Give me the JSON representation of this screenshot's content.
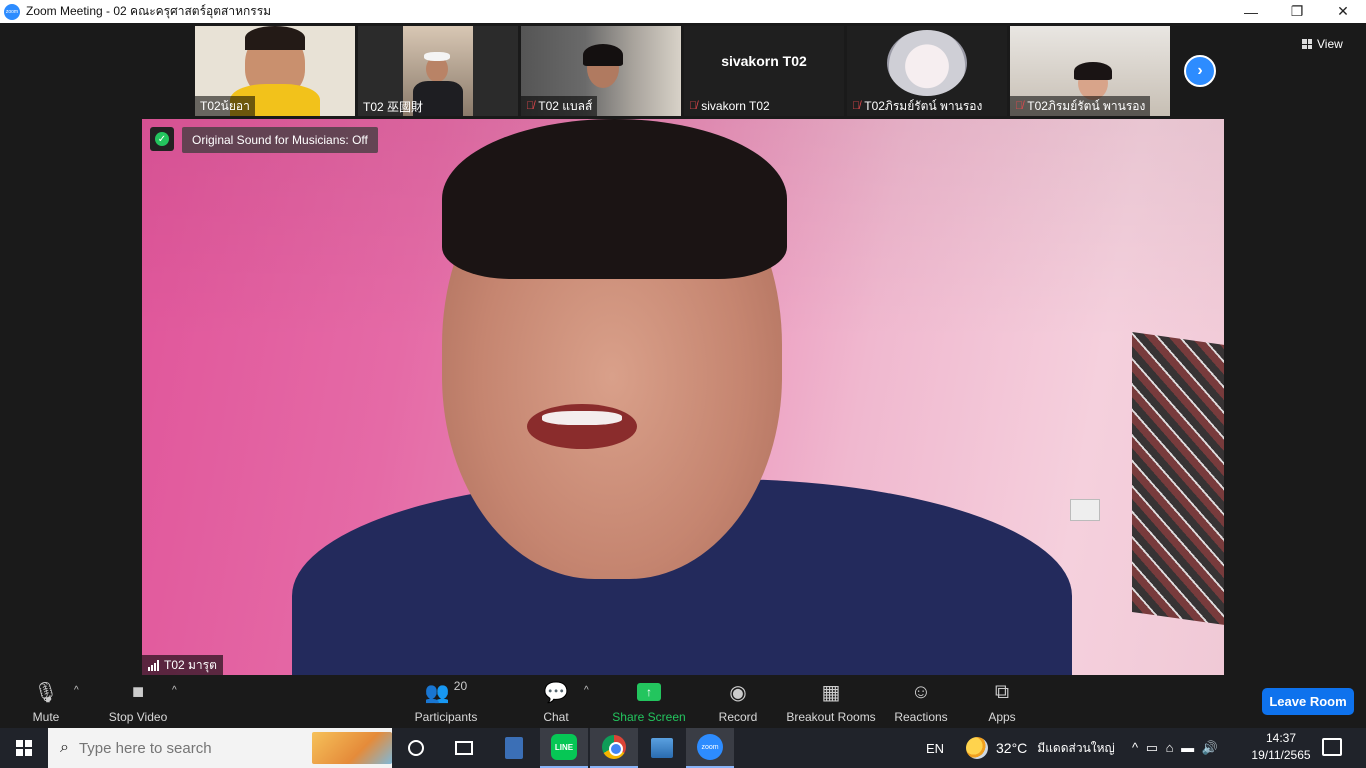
{
  "window": {
    "title": "Zoom Meeting - 02 คณะครุศาสตร์อุตสาหกรรม",
    "logo_text": "zoom",
    "controls": [
      "—",
      "❐",
      "✕"
    ]
  },
  "strip": {
    "thumbnails": [
      {
        "name": "T02น้ยอา",
        "muted": false,
        "has_video": true,
        "bg": "#d9d0c4"
      },
      {
        "name": "T02 巫國財",
        "muted": false,
        "has_video": true,
        "bg": "#3a3a3a"
      },
      {
        "name": "T02 แบลส์",
        "muted": true,
        "has_video": true,
        "bg": "#4a4a4a"
      },
      {
        "name": "sivakorn T02",
        "muted": true,
        "has_video": false,
        "display_title": "sivakorn T02",
        "bg": "#1f1f1f"
      },
      {
        "name": "T02ภิรมย์รัตน์ พานรอง",
        "muted": true,
        "has_video": true,
        "bg": "#1f1f1f"
      },
      {
        "name": "T02ภิรมย์รัตน์ พานรอง",
        "muted": true,
        "has_video": true,
        "bg": "#c9c3bd"
      }
    ],
    "next_icon": "›",
    "view_label": "View"
  },
  "main": {
    "original_sound": "Original Sound for Musicians: Off",
    "speaker_name": "T02 มารุต",
    "shield_icon": "✓"
  },
  "toolbar": {
    "mute": {
      "label": "Mute",
      "icon": "🎙"
    },
    "video": {
      "label": "Stop Video",
      "icon": "■"
    },
    "participants": {
      "label": "Participants",
      "count": "20",
      "icon": "👥"
    },
    "chat": {
      "label": "Chat",
      "icon": "💬"
    },
    "share": {
      "label": "Share Screen",
      "icon": "↑"
    },
    "record": {
      "label": "Record",
      "icon": "◉"
    },
    "breakout": {
      "label": "Breakout Rooms",
      "icon": "▦"
    },
    "reactions": {
      "label": "Reactions",
      "icon": "☺"
    },
    "apps": {
      "label": "Apps",
      "icon": "⧉"
    },
    "caret": "^",
    "leave": "Leave Room"
  },
  "taskbar": {
    "search_placeholder": "Type here to search",
    "line_label": "LINE",
    "zoom_label": "zoom",
    "lang": "EN",
    "temperature": "32°C",
    "weather_text": "มีแดดส่วนใหญ่",
    "tray_icons": "^  ▭  ⌂  ▬  🔊",
    "time": "14:37",
    "date": "19/11/2565"
  }
}
